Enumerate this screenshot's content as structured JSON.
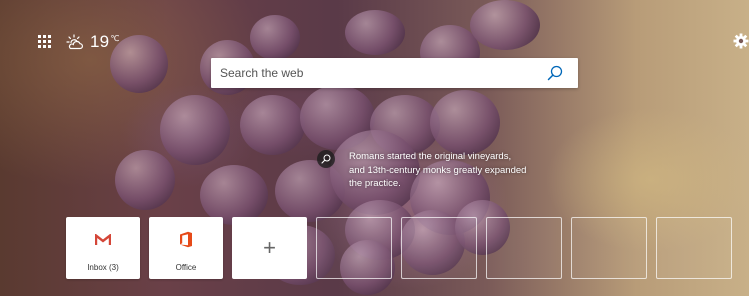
{
  "apps_icon": "waffle-grid-icon",
  "weather": {
    "icon": "partly-sunny-icon",
    "temperature": "19",
    "unit": "℃"
  },
  "settings_icon": "gear-icon",
  "search": {
    "placeholder": "Search the web",
    "icon": "search-icon"
  },
  "fact": {
    "icon": "search-icon",
    "text": "Romans started the original vineyards, and 13th-century monks greatly expanded the practice."
  },
  "tiles": [
    {
      "label": "Inbox (3)",
      "icon": "gmail-icon",
      "color": "#d44638"
    },
    {
      "label": "Office",
      "icon": "office-icon",
      "color": "#e64a19"
    },
    {
      "label": "+",
      "icon": "plus-icon"
    }
  ],
  "empty_tile_count": 5
}
